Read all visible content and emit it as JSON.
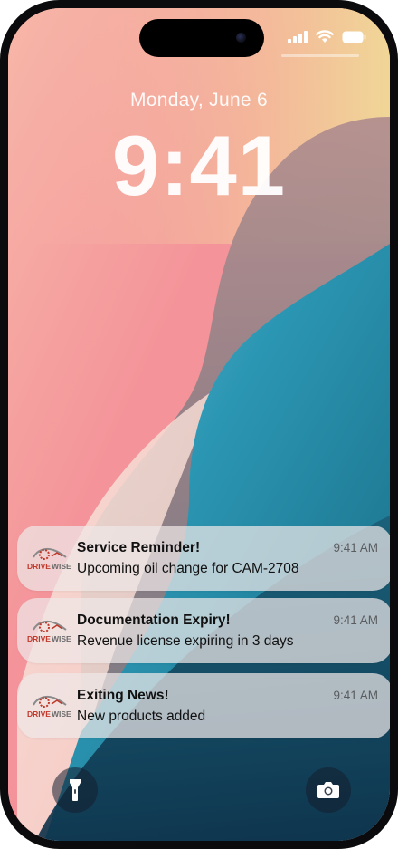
{
  "lockscreen": {
    "date": "Monday, June 6",
    "time": "9:41"
  },
  "status_bar": {
    "icons": [
      "cellular-signal-icon",
      "wifi-icon",
      "battery-icon"
    ]
  },
  "notifications": [
    {
      "app_logo": "drivewise-logo",
      "app_logo_text": "DRIVEWISE",
      "title": "Service Reminder!",
      "body": "Upcoming oil change for CAM-2708",
      "time": "9:41 AM"
    },
    {
      "app_logo": "drivewise-logo",
      "app_logo_text": "DRIVEWISE",
      "title": "Documentation Expiry!",
      "body": "Revenue license expiring in 3 days",
      "time": "9:41 AM"
    },
    {
      "app_logo": "drivewise-logo",
      "app_logo_text": "DRIVEWISE",
      "title": "Exiting News!",
      "body": "New products added",
      "time": "9:41 AM"
    }
  ],
  "quick_actions": {
    "left": "flashlight-icon",
    "right": "camera-icon"
  },
  "colors": {
    "logo_red": "#c0392b",
    "logo_gray": "#6b6b6b",
    "wallpaper_teal": "#1d7c95",
    "wallpaper_navy": "#0f3853"
  }
}
